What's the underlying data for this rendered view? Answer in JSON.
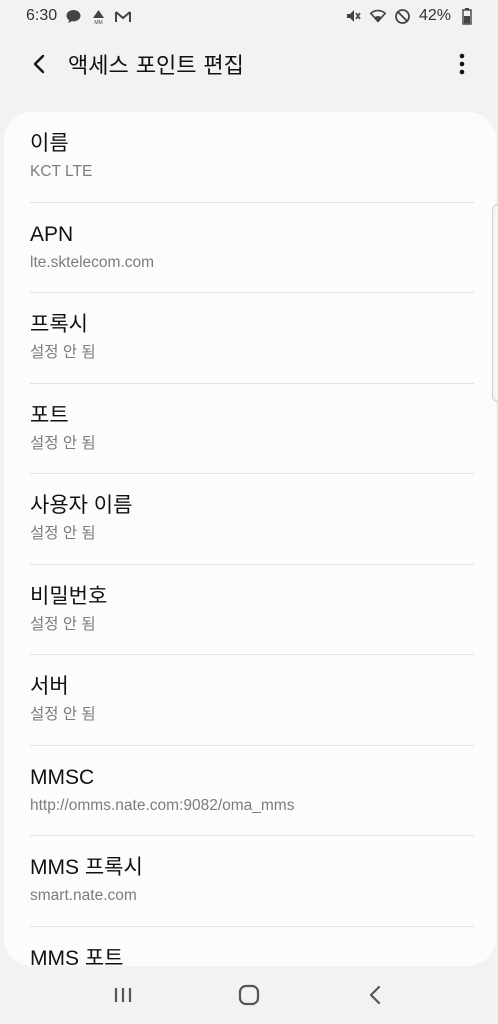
{
  "status_bar": {
    "time": "6:30",
    "battery": "42%",
    "icons_left": [
      "chat-bubble-icon",
      "warning-mm-icon",
      "gmail-icon"
    ],
    "icons_right": [
      "mute-icon",
      "wifi-icon",
      "block-icon",
      "battery-icon"
    ]
  },
  "header": {
    "title": "액세스 포인트 편집",
    "back_icon": "chevron-left-icon",
    "more_icon": "more-vertical-icon"
  },
  "items": [
    {
      "label": "이름",
      "value": "KCT LTE"
    },
    {
      "label": "APN",
      "value": "lte.sktelecom.com"
    },
    {
      "label": "프록시",
      "value": "설정 안 됨"
    },
    {
      "label": "포트",
      "value": "설정 안 됨"
    },
    {
      "label": "사용자 이름",
      "value": "설정 안 됨"
    },
    {
      "label": "비밀번호",
      "value": "설정 안 됨"
    },
    {
      "label": "서버",
      "value": "설정 안 됨"
    },
    {
      "label": "MMSC",
      "value": "http://omms.nate.com:9082/oma_mms"
    },
    {
      "label": "MMS 프록시",
      "value": "smart.nate.com"
    },
    {
      "label": "MMS 포트",
      "value": ""
    }
  ],
  "nav_bar": {
    "icons": [
      "recents-icon",
      "home-icon",
      "back-icon"
    ]
  }
}
